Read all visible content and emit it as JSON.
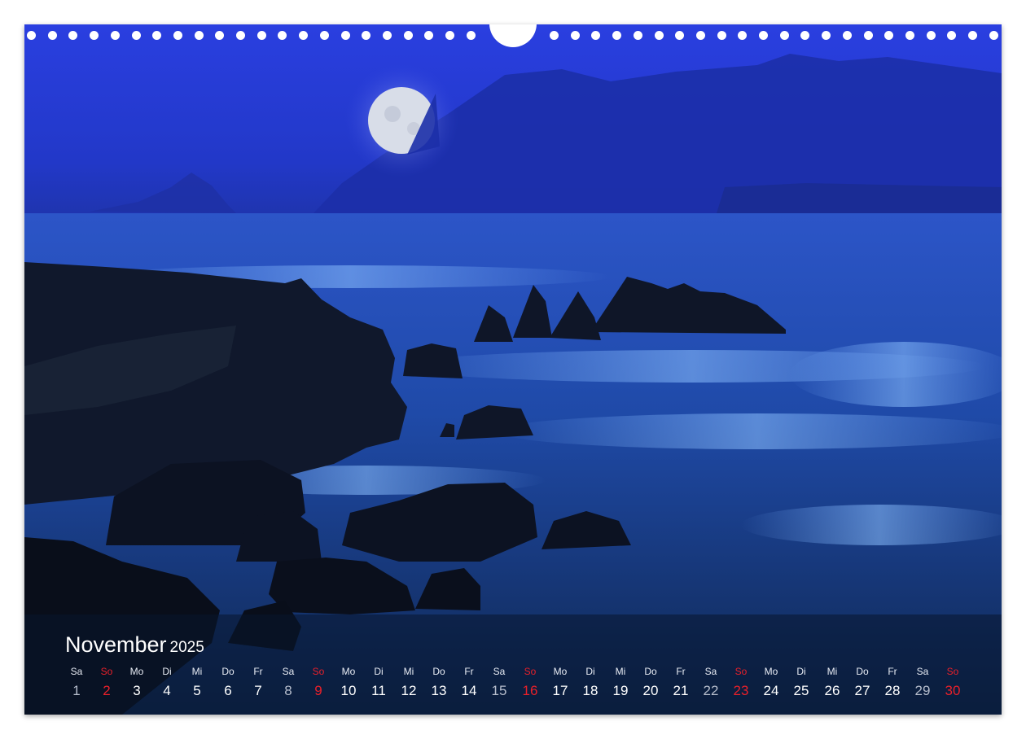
{
  "calendar": {
    "month": "November",
    "year": "2025",
    "days": [
      {
        "name": "Sa",
        "num": "1",
        "type": "sat"
      },
      {
        "name": "So",
        "num": "2",
        "type": "sun"
      },
      {
        "name": "Mo",
        "num": "3",
        "type": "wk"
      },
      {
        "name": "Di",
        "num": "4",
        "type": "wk"
      },
      {
        "name": "Mi",
        "num": "5",
        "type": "wk"
      },
      {
        "name": "Do",
        "num": "6",
        "type": "wk"
      },
      {
        "name": "Fr",
        "num": "7",
        "type": "wk"
      },
      {
        "name": "Sa",
        "num": "8",
        "type": "sat"
      },
      {
        "name": "So",
        "num": "9",
        "type": "sun"
      },
      {
        "name": "Mo",
        "num": "10",
        "type": "wk"
      },
      {
        "name": "Di",
        "num": "11",
        "type": "wk"
      },
      {
        "name": "Mi",
        "num": "12",
        "type": "wk"
      },
      {
        "name": "Do",
        "num": "13",
        "type": "wk"
      },
      {
        "name": "Fr",
        "num": "14",
        "type": "wk"
      },
      {
        "name": "Sa",
        "num": "15",
        "type": "sat"
      },
      {
        "name": "So",
        "num": "16",
        "type": "sun"
      },
      {
        "name": "Mo",
        "num": "17",
        "type": "wk"
      },
      {
        "name": "Di",
        "num": "18",
        "type": "wk"
      },
      {
        "name": "Mi",
        "num": "19",
        "type": "wk"
      },
      {
        "name": "Do",
        "num": "20",
        "type": "wk"
      },
      {
        "name": "Fr",
        "num": "21",
        "type": "wk"
      },
      {
        "name": "Sa",
        "num": "22",
        "type": "sat"
      },
      {
        "name": "So",
        "num": "23",
        "type": "sun"
      },
      {
        "name": "Mo",
        "num": "24",
        "type": "wk"
      },
      {
        "name": "Di",
        "num": "25",
        "type": "wk"
      },
      {
        "name": "Mi",
        "num": "26",
        "type": "wk"
      },
      {
        "name": "Do",
        "num": "27",
        "type": "wk"
      },
      {
        "name": "Fr",
        "num": "28",
        "type": "wk"
      },
      {
        "name": "Sa",
        "num": "29",
        "type": "sat"
      },
      {
        "name": "So",
        "num": "30",
        "type": "sun"
      }
    ]
  },
  "colors": {
    "sunday": "#e8202a",
    "saturday": "#b5bccb",
    "weekday": "#ffffff",
    "sky": "#2a3fe0"
  }
}
